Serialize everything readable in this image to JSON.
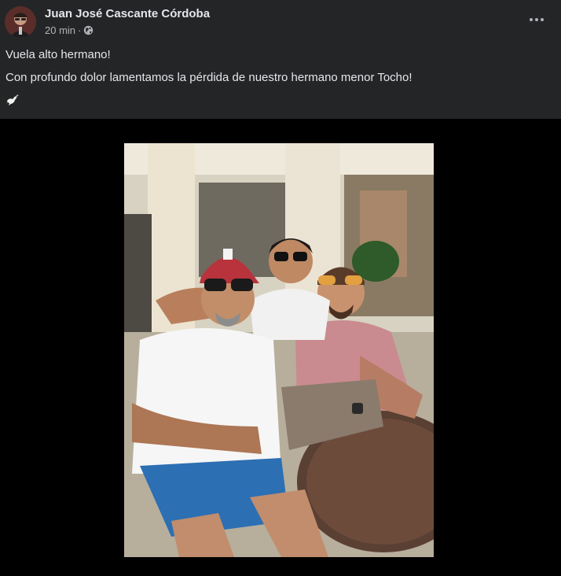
{
  "post": {
    "author": "Juan José Cascante Córdoba",
    "time": "20 min",
    "separator": "·",
    "privacy_icon": "globe-icon",
    "more_icon": "more-options-icon",
    "lines": [
      "Vuela alto hermano!",
      "Con profundo dolor lamentamos la pérdida de nuestro hermano menor Tocho!"
    ],
    "emoji": "dove-icon"
  },
  "colors": {
    "post_background": "#242526",
    "media_background": "#000000",
    "primary_text": "#e4e6eb",
    "secondary_text": "#b0b3b8"
  }
}
